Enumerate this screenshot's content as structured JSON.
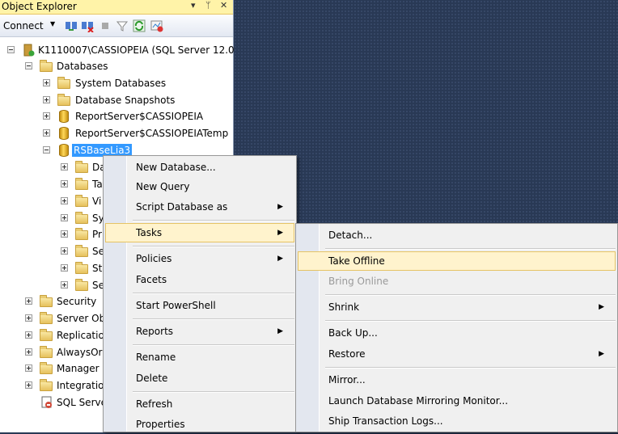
{
  "panel": {
    "title": "Object Explorer",
    "title_controls": [
      "▾",
      "ᛘ",
      "✕"
    ],
    "toolbar": {
      "connect_label": "Connect",
      "icons": [
        "connect-object-explorer-icon",
        "disconnect-icon",
        "stop-icon",
        "filter-icon",
        "refresh-icon",
        "activity-monitor-icon"
      ]
    }
  },
  "tree": {
    "server": "K1110007\\CASSIOPEIA (SQL Server 12.0",
    "databases": "Databases",
    "system_databases": "System Databases",
    "database_snapshots": "Database Snapshots",
    "reportserver": "ReportServer$CASSIOPEIA",
    "reportserver_temp": "ReportServer$CASSIOPEIATemp",
    "selected_db": "RSBaseLia3",
    "child_labels": [
      "Da",
      "Ta",
      "Vi",
      "Sy",
      "Pr",
      "Se",
      "St",
      "Se"
    ],
    "security": "Security",
    "server_objects": "Server Ob",
    "replication": "Replicatio",
    "alwayson": "AlwaysOr",
    "management": "Manager",
    "integration": "Integratio",
    "sql_agent": "SQL Serve"
  },
  "context_menu": {
    "new_database": "New Database...",
    "new_query": "New Query",
    "script_database_as": "Script Database as",
    "tasks": "Tasks",
    "policies": "Policies",
    "facets": "Facets",
    "start_powershell": "Start PowerShell",
    "reports": "Reports",
    "rename": "Rename",
    "delete": "Delete",
    "refresh": "Refresh",
    "properties": "Properties"
  },
  "tasks_menu": {
    "detach": "Detach...",
    "take_offline": "Take Offline",
    "bring_online": "Bring Online",
    "shrink": "Shrink",
    "back_up": "Back Up...",
    "restore": "Restore",
    "mirror": "Mirror...",
    "launch_mirroring_monitor": "Launch Database Mirroring Monitor...",
    "ship_transaction_logs": "Ship Transaction Logs..."
  },
  "arrow_glyph": "▶"
}
